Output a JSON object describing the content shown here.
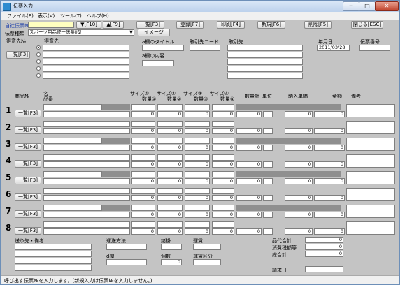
{
  "window": {
    "title": "伝票入力",
    "min": "─",
    "max": "□",
    "close": "✕"
  },
  "menu": [
    "ファイル(E)",
    "表示(V)",
    "ツール(T)",
    "ヘルプ(H)"
  ],
  "header": {
    "slip_no_label": "自社伝票№",
    "slip_no_value": "",
    "toolbar": [
      {
        "id": "f10",
        "label": "▼[F10]"
      },
      {
        "id": "f9",
        "label": "▲[F9]"
      },
      {
        "id": "f3",
        "label": "一覧[F3]"
      },
      {
        "id": "f7",
        "label": "登録[F7]"
      },
      {
        "id": "f4",
        "label": "印刷[F4]"
      },
      {
        "id": "f6",
        "label": "新規[F6]"
      },
      {
        "id": "f5",
        "label": "削除[F5]"
      },
      {
        "id": "esc",
        "label": "閉じる[ESC]"
      }
    ],
    "slip_type_label": "伝票種類",
    "slip_type_value": "スポーツ用品統一伝票Ⅱ型",
    "image_button": "イメージ"
  },
  "customer": {
    "code_label": "得意先№",
    "list_button": "一覧[F3]",
    "name_label": "得意先",
    "a_title_label": "a欄のタイトル",
    "a_content_label": "a欄の内容",
    "supplier_code_label": "取引先コード",
    "supplier_label": "取引先",
    "date_label": "年月日",
    "date_value": "2011/03/28",
    "slip_number_label": "伝票番号"
  },
  "columns": {
    "product_no": "商品№",
    "name": "名",
    "item_no": "品番",
    "size1": "サイズ①",
    "qty1": "数量①",
    "size2": "サイズ②",
    "qty2": "数量②",
    "size3": "サイズ③",
    "qty3": "数量③",
    "size4": "サイズ④",
    "qty4": "数量④",
    "qty_total": "数量計",
    "unit": "単位",
    "unit_price": "納入単価",
    "amount": "金額",
    "remarks": "備考"
  },
  "rows": [
    {
      "n": "1",
      "btn": "一覧[F3]",
      "q1": "0",
      "q2": "0",
      "q3": "0",
      "q4": "0",
      "qt": "0",
      "price": "0",
      "amount": "0"
    },
    {
      "n": "2",
      "btn": "一覧[F3]",
      "q1": "0",
      "q2": "0",
      "q3": "0",
      "q4": "0",
      "qt": "0",
      "price": "0",
      "amount": "0"
    },
    {
      "n": "3",
      "btn": "一覧[F3]",
      "q1": "0",
      "q2": "0",
      "q3": "0",
      "q4": "0",
      "qt": "0",
      "price": "0",
      "amount": "0"
    },
    {
      "n": "4",
      "btn": "一覧[F3]",
      "q1": "0",
      "q2": "0",
      "q3": "0",
      "q4": "0",
      "qt": "0",
      "price": "0",
      "amount": "0"
    },
    {
      "n": "5",
      "btn": "一覧[F3]",
      "q1": "0",
      "q2": "0",
      "q3": "0",
      "q4": "0",
      "qt": "0",
      "price": "0",
      "amount": "0"
    },
    {
      "n": "6",
      "btn": "一覧[F3]",
      "q1": "0",
      "q2": "0",
      "q3": "0",
      "q4": "0",
      "qt": "0",
      "price": "0",
      "amount": "0"
    },
    {
      "n": "7",
      "btn": "一覧[F3]",
      "q1": "0",
      "q2": "0",
      "q3": "0",
      "q4": "0",
      "qt": "0",
      "price": "0",
      "amount": "0"
    },
    {
      "n": "8",
      "btn": "一覧[F3]",
      "q1": "0",
      "q2": "0",
      "q3": "0",
      "q4": "0",
      "qt": "0",
      "price": "0",
      "amount": "0"
    }
  ],
  "footer": {
    "ship_to_label": "送り先・備考",
    "ship_method_label": "運送方法",
    "d_label": "d欄",
    "unit_label": "諸掛",
    "count_label": "個数",
    "count_value": "0",
    "freight_label": "運賃",
    "freight_class_label": "運賃区分",
    "product_total_label": "品代合計",
    "product_total_value": "0",
    "tax_label": "消費税額等",
    "tax_value": "0",
    "grand_total_label": "総合計",
    "grand_total_value": "0",
    "invoice_date_label": "請求日"
  },
  "status": "呼び出す伝票№を入力します。(新規入力は伝票№を入力しません。)"
}
